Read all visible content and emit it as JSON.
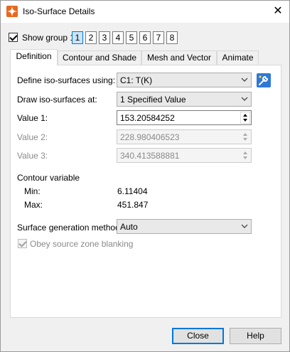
{
  "window": {
    "title": "Iso-Surface Details",
    "close_label": "✕"
  },
  "group": {
    "show_label": "Show group 1",
    "show_checked": true,
    "buttons": [
      "1",
      "2",
      "3",
      "4",
      "5",
      "6",
      "7",
      "8"
    ],
    "active": "1"
  },
  "tabs": [
    "Definition",
    "Contour and Shade",
    "Mesh and Vector",
    "Animate"
  ],
  "active_tab": "Definition",
  "definition": {
    "define_label": "Define iso-surfaces using:",
    "define_value": "C1: T(K)",
    "draw_label": "Draw iso-surfaces at:",
    "draw_value": "1 Specified Value",
    "value1_label": "Value 1:",
    "value1": "153.20584252",
    "value2_label": "Value 2:",
    "value2": "228.980406523",
    "value3_label": "Value 3:",
    "value3": "340.413588881",
    "contour_var_label": "Contour variable",
    "min_label": "Min:",
    "min_value": "6.11404",
    "max_label": "Max:",
    "max_value": "451.847",
    "method_label": "Surface generation method:",
    "method_value": "Auto",
    "blanking_label": "Obey source zone blanking",
    "blanking_checked": true
  },
  "footer": {
    "close_label": "Close",
    "help_label": "Help"
  }
}
